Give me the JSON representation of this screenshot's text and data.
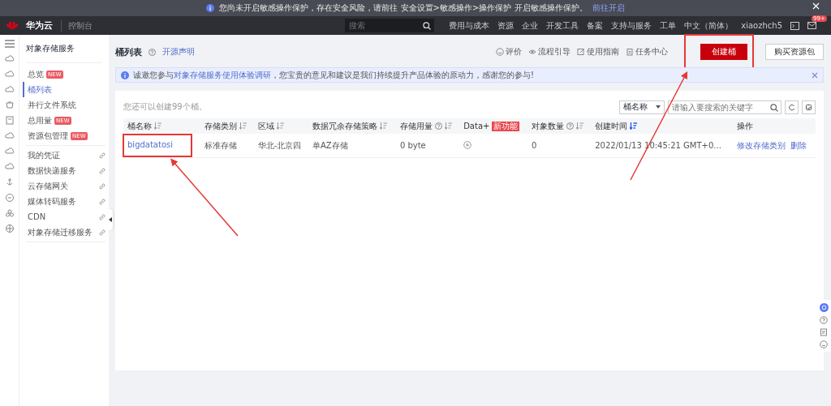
{
  "notice": {
    "text": "您尚未开启敏感操作保护，存在安全风险，请前往 安全设置>敏感操作>操作保护 开启敏感操作保护。",
    "link": "前往开启"
  },
  "topbar": {
    "brand": "华为云",
    "console": "控制台",
    "search": {
      "placeholder": "搜索"
    },
    "links": [
      "费用与成本",
      "资源",
      "企业",
      "开发工具",
      "备案",
      "支持与服务",
      "工单",
      "中文（简体）",
      "xiaozhch5"
    ],
    "badge": "99+"
  },
  "sidebar": {
    "title": "对象存储服务",
    "groups": [
      [
        {
          "label": "总览",
          "badge": "NEW",
          "external": false,
          "selected": false
        },
        {
          "label": "桶列表",
          "external": false,
          "selected": true
        },
        {
          "label": "并行文件系统",
          "external": false,
          "selected": false
        },
        {
          "label": "总用量",
          "badge": "NEW",
          "external": false,
          "selected": false
        },
        {
          "label": "资源包管理",
          "badge": "NEW",
          "external": false,
          "selected": false
        }
      ],
      [
        {
          "label": "我的凭证",
          "external": true,
          "selected": false
        },
        {
          "label": "数据快递服务",
          "external": true,
          "selected": false
        },
        {
          "label": "云存储网关",
          "external": true,
          "selected": false
        },
        {
          "label": "媒体转码服务",
          "external": true,
          "selected": false
        },
        {
          "label": "CDN",
          "external": true,
          "selected": false
        },
        {
          "label": "对象存储迁移服务",
          "external": true,
          "selected": false
        }
      ]
    ]
  },
  "page": {
    "title": "桶列表",
    "link": "开源声明",
    "tools": [
      {
        "kind": "rate",
        "label": "评价"
      },
      {
        "kind": "guide",
        "label": "流程引导"
      },
      {
        "kind": "doc",
        "label": "使用指南"
      },
      {
        "kind": "task",
        "label": "任务中心"
      }
    ],
    "create_button": {
      "label": "创建桶",
      "highlight": true
    },
    "buy_button": "购买资源包",
    "survey": {
      "before": "诚邀您参与",
      "link": "对象存储服务使用体验调研",
      "after": "，您宝贵的意见和建议是我们持续提升产品体验的原动力，感谢您的参与!"
    }
  },
  "table": {
    "quota": "您还可以创建99个桶。",
    "filter": {
      "field": "桶名称",
      "placeholder": "请输入要搜索的关键字"
    },
    "columns": [
      {
        "label": "桶名称",
        "help": false,
        "sortable": true,
        "sorted": false
      },
      {
        "label": "存储类别",
        "help": false,
        "sortable": true,
        "sorted": false
      },
      {
        "label": "区域",
        "help": false,
        "sortable": true,
        "sorted": false
      },
      {
        "label": "数据冗余存储策略",
        "help": false,
        "sortable": true,
        "sorted": false
      },
      {
        "label": "存储用量",
        "help": true,
        "sortable": true,
        "sorted": false
      },
      {
        "label": "Data+",
        "badge": "新功能",
        "help": false,
        "sortable": false
      },
      {
        "label": "对象数量",
        "help": true,
        "sortable": true,
        "sorted": false
      },
      {
        "label": "创建时间",
        "help": false,
        "sortable": true,
        "sorted": true
      },
      {
        "label": "操作",
        "help": false,
        "sortable": false
      }
    ],
    "rows": [
      {
        "name": "bigdatatosi",
        "highlight": true,
        "storage_class": "标准存储",
        "region": "华北-北京四",
        "redundancy": "单AZ存储",
        "usage": "0 byte",
        "objects": "0",
        "created": "2022/01/13 10:45:21 GMT+0...",
        "actions": [
          "修改存储类别",
          "删除"
        ]
      }
    ]
  }
}
